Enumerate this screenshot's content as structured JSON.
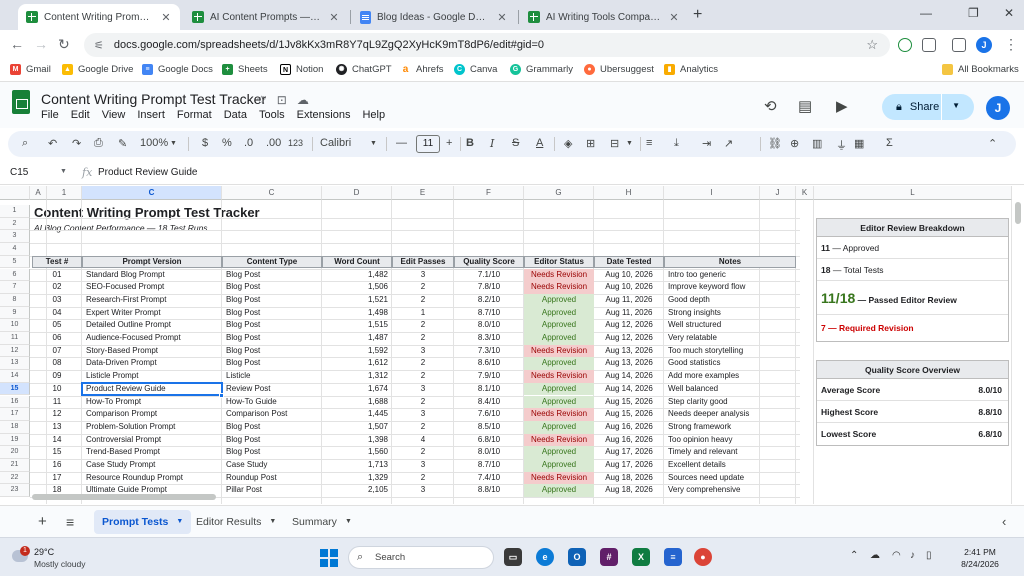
{
  "browser": {
    "tabs": [
      {
        "title": "Content Writing Prompt Test Tra",
        "icon": "sheets-icon",
        "active": true
      },
      {
        "title": "AI Content Prompts — 40 Tested",
        "icon": "sheets-icon",
        "active": false
      },
      {
        "title": "Blog Ideas - Google Docs",
        "icon": "docs-icon",
        "active": false
      },
      {
        "title": "AI Writing Tools Comparison - Go",
        "icon": "sheets-icon",
        "active": false
      }
    ],
    "url": "docs.google.com/spreadsheets/d/1Jv8kKx3mR8Y7qL9ZgQ2XyHcK9mT8dP6/edit#gid=0",
    "profile_initial": "J",
    "bookmarks": [
      "Gmail",
      "Google Drive",
      "Google Docs",
      "Sheets",
      "Notion",
      "ChatGPT",
      "Ahrefs",
      "Canva",
      "Grammarly",
      "Ubersuggest",
      "Analytics"
    ],
    "all_bookmarks": "All Bookmarks"
  },
  "app": {
    "title": "Content Writing Prompt Test Tracker",
    "menus": [
      "File",
      "Edit",
      "View",
      "Insert",
      "Format",
      "Data",
      "Tools",
      "Extensions",
      "Help"
    ],
    "share_label": "Share",
    "profile_initial": "J"
  },
  "toolbar": {
    "zoom": "100%",
    "currency": "$",
    "percent": "%",
    "dec_less": ".0",
    "dec_more": ".00",
    "number_format": "123",
    "font": "Calibri",
    "font_size": "11"
  },
  "formula": {
    "cell_ref": "C15",
    "value": "Product Review Guide"
  },
  "grid": {
    "col_headers": [
      "1",
      "A",
      "1",
      "C",
      "C",
      "D",
      "E",
      "F",
      "G",
      "H",
      "I",
      "J",
      "K",
      "L"
    ],
    "selected_row": "15",
    "title": "Content Writing Prompt Test Tracker",
    "subtitle": "AI Blog Content Performance — 18 Test Runs",
    "headers": [
      "Test #",
      "Prompt Version",
      "Content Type",
      "Word Count",
      "Edit Passes",
      "Quality Score",
      "Editor Status",
      "Date Tested",
      "Notes"
    ],
    "rows": [
      [
        "01",
        "Standard Blog Prompt",
        "Blog Post",
        "1,482",
        "3",
        "7.1/10",
        "Needs Revision",
        "Aug 10, 2026",
        "Intro too generic"
      ],
      [
        "02",
        "SEO-Focused Prompt",
        "Blog Post",
        "1,506",
        "2",
        "7.8/10",
        "Needs Revision",
        "Aug 10, 2026",
        "Improve keyword flow"
      ],
      [
        "03",
        "Research-First Prompt",
        "Blog Post",
        "1,521",
        "2",
        "8.2/10",
        "Approved",
        "Aug 11, 2026",
        "Good depth"
      ],
      [
        "04",
        "Expert Writer Prompt",
        "Blog Post",
        "1,498",
        "1",
        "8.7/10",
        "Approved",
        "Aug 11, 2026",
        "Strong insights"
      ],
      [
        "05",
        "Detailed Outline Prompt",
        "Blog Post",
        "1,515",
        "2",
        "8.0/10",
        "Approved",
        "Aug 12, 2026",
        "Well structured"
      ],
      [
        "06",
        "Audience-Focused Prompt",
        "Blog Post",
        "1,487",
        "2",
        "8.3/10",
        "Approved",
        "Aug 12, 2026",
        "Very relatable"
      ],
      [
        "07",
        "Story-Based Prompt",
        "Blog Post",
        "1,592",
        "3",
        "7.3/10",
        "Needs Revision",
        "Aug 13, 2026",
        "Too much storytelling"
      ],
      [
        "08",
        "Data-Driven Prompt",
        "Blog Post",
        "1,612",
        "2",
        "8.6/10",
        "Approved",
        "Aug 13, 2026",
        "Good statistics"
      ],
      [
        "09",
        "Listicle Prompt",
        "Listicle",
        "1,312",
        "2",
        "7.9/10",
        "Needs Revision",
        "Aug 14, 2026",
        "Add more examples"
      ],
      [
        "10",
        "Product Review Guide",
        "Review Post",
        "1,674",
        "3",
        "8.1/10",
        "Approved",
        "Aug 14, 2026",
        "Well balanced"
      ],
      [
        "11",
        "How-To Prompt",
        "How-To Guide",
        "1,688",
        "2",
        "8.4/10",
        "Approved",
        "Aug 15, 2026",
        "Step clarity good"
      ],
      [
        "12",
        "Comparison Prompt",
        "Comparison Post",
        "1,445",
        "3",
        "7.6/10",
        "Needs Revision",
        "Aug 15, 2026",
        "Needs deeper analysis"
      ],
      [
        "13",
        "Problem-Solution Prompt",
        "Blog Post",
        "1,507",
        "2",
        "8.5/10",
        "Approved",
        "Aug 16, 2026",
        "Strong framework"
      ],
      [
        "14",
        "Controversial Prompt",
        "Blog Post",
        "1,398",
        "4",
        "6.8/10",
        "Needs Revision",
        "Aug 16, 2026",
        "Too opinion heavy"
      ],
      [
        "15",
        "Trend-Based Prompt",
        "Blog Post",
        "1,560",
        "2",
        "8.0/10",
        "Approved",
        "Aug 17, 2026",
        "Timely and relevant"
      ],
      [
        "16",
        "Case Study Prompt",
        "Case Study",
        "1,713",
        "3",
        "8.7/10",
        "Approved",
        "Aug 17, 2026",
        "Excellent details"
      ],
      [
        "17",
        "Resource Roundup Prompt",
        "Roundup Post",
        "1,329",
        "2",
        "7.4/10",
        "Needs Revision",
        "Aug 18, 2026",
        "Sources need update"
      ],
      [
        "18",
        "Ultimate Guide Prompt",
        "Pillar Post",
        "2,105",
        "3",
        "8.8/10",
        "Approved",
        "Aug 18, 2026",
        "Very comprehensive"
      ]
    ]
  },
  "editor_panel": {
    "title": "Editor Review Breakdown",
    "approved_num": "11",
    "approved_label": "— Approved",
    "total_num": "18",
    "total_label": "— Total Tests",
    "passed_ratio": "11/18",
    "passed_label": "— Passed Editor Review",
    "revision_num": "7",
    "revision_label": "— Required Revision"
  },
  "quality_panel": {
    "title": "Quality Score Overview",
    "rows": [
      {
        "label": "Average Score",
        "value": "8.0/10"
      },
      {
        "label": "Highest Score",
        "value": "8.8/10"
      },
      {
        "label": "Lowest Score",
        "value": "6.8/10"
      }
    ]
  },
  "sheet_tabs": {
    "add": "+",
    "menu": "≡",
    "tabs": [
      "Prompt Tests",
      "Editor Results",
      "Summary"
    ]
  },
  "taskbar": {
    "weather_temp": "29°C",
    "weather_desc": "Mostly cloudy",
    "weather_badge": "1",
    "search_placeholder": "Search",
    "time": "2:41 PM",
    "date": "8/24/2026"
  },
  "colors": {
    "approved_bg": "#d9ead3",
    "approved_text": "#38761d",
    "revision_bg": "#f4cccc",
    "revision_text": "#990000",
    "passed_green": "#38761d",
    "revision_red": "#cc0000",
    "share_bg": "#c2e7ff",
    "selection_blue": "#1a73e8"
  }
}
